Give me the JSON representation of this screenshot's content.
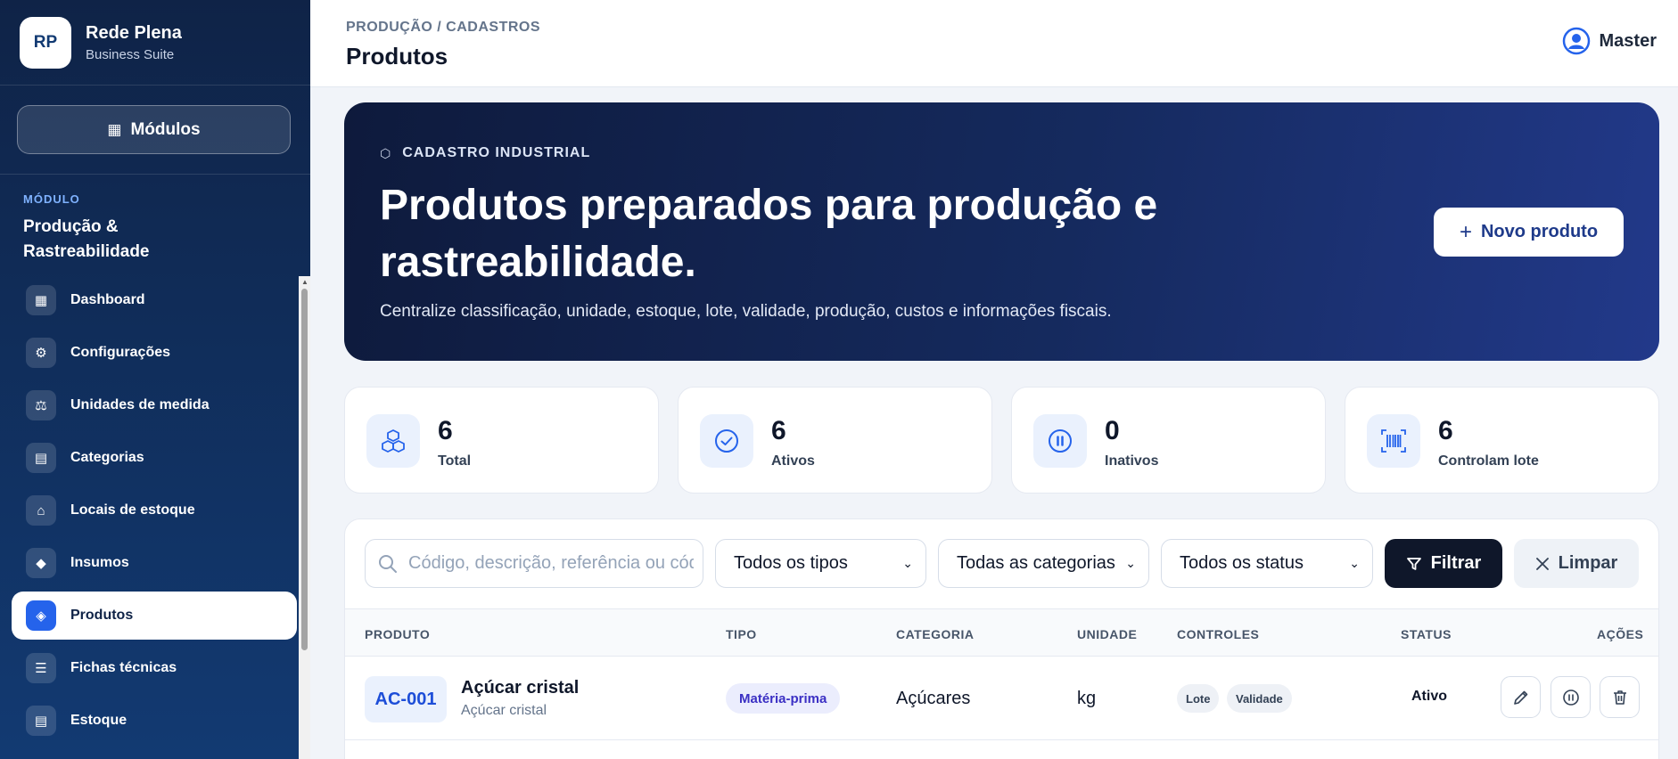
{
  "brand": {
    "logo": "RP",
    "name": "Rede Plena",
    "subtitle": "Business Suite"
  },
  "sidebar": {
    "modules_label": "Módulos",
    "module_caption": "MÓDULO",
    "module_name": "Produção & Rastreabilidade",
    "items": [
      {
        "label": "Dashboard",
        "icon": "▦"
      },
      {
        "label": "Configurações",
        "icon": "⚙"
      },
      {
        "label": "Unidades de medida",
        "icon": "⚖"
      },
      {
        "label": "Categorias",
        "icon": "▤"
      },
      {
        "label": "Locais de estoque",
        "icon": "⌂"
      },
      {
        "label": "Insumos",
        "icon": "◆"
      },
      {
        "label": "Produtos",
        "icon": "◈",
        "active": true
      },
      {
        "label": "Fichas técnicas",
        "icon": "☰"
      },
      {
        "label": "Estoque",
        "icon": "▤"
      }
    ]
  },
  "header": {
    "breadcrumb": "PRODUÇÃO / CADASTROS",
    "title": "Produtos",
    "user": "Master"
  },
  "hero": {
    "tag": "CADASTRO INDUSTRIAL",
    "title": "Produtos preparados para produção e rastreabilidade.",
    "description": "Centralize classificação, unidade, estoque, lote, validade, produção, custos e informações fiscais.",
    "new_button": "Novo produto"
  },
  "stats": [
    {
      "value": "6",
      "label": "Total",
      "icon": "cubes-icon"
    },
    {
      "value": "6",
      "label": "Ativos",
      "icon": "check-circle-icon"
    },
    {
      "value": "0",
      "label": "Inativos",
      "icon": "pause-circle-icon"
    },
    {
      "value": "6",
      "label": "Controlam lote",
      "icon": "barcode-icon"
    }
  ],
  "filters": {
    "search_placeholder": "Código, descrição, referência ou código de barras",
    "type": "Todos os tipos",
    "category": "Todas as categorias",
    "status": "Todos os status",
    "filter_button": "Filtrar",
    "clear_button": "Limpar"
  },
  "table": {
    "headers": [
      "PRODUTO",
      "TIPO",
      "CATEGORIA",
      "UNIDADE",
      "CONTROLES",
      "STATUS",
      "AÇÕES"
    ],
    "rows": [
      {
        "code": "AC-001",
        "name": "Açúcar cristal",
        "reference": "Açúcar cristal",
        "type": "Matéria-prima",
        "category": "Açúcares",
        "unit": "kg",
        "controls": [
          "Lote",
          "Validade"
        ],
        "status": "Ativo"
      }
    ]
  },
  "colors": {
    "accent": "#2563eb",
    "sidebar": "#0f2347",
    "hero": "#152a5e"
  }
}
